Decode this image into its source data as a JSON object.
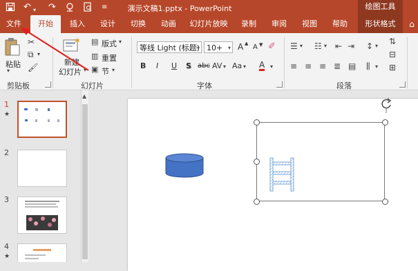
{
  "titlebar": {
    "title": "演示文稿1.pptx - PowerPoint",
    "context_header": "绘图工具",
    "qa_icons": [
      "save-icon",
      "undo-icon",
      "redo-icon",
      "touch-mode-icon",
      "preview-icon",
      "customize-icon"
    ]
  },
  "tabs": [
    {
      "label": "文件"
    },
    {
      "label": "开始"
    },
    {
      "label": "插入"
    },
    {
      "label": "设计"
    },
    {
      "label": "切换"
    },
    {
      "label": "动画"
    },
    {
      "label": "幻灯片放映"
    },
    {
      "label": "录制"
    },
    {
      "label": "审阅"
    },
    {
      "label": "视图"
    },
    {
      "label": "帮助"
    },
    {
      "label": "形状格式"
    }
  ],
  "ribbon": {
    "clipboard": {
      "label": "剪贴板",
      "paste": "粘贴"
    },
    "slides": {
      "label": "幻灯片",
      "new_slide_l1": "新建",
      "new_slide_l2": "幻灯片",
      "layout": "版式",
      "reset": "重置",
      "section": "节"
    },
    "font": {
      "label": "字体",
      "font_name": "等线 Light (标题)",
      "font_size": "10+",
      "bold": "B",
      "italic": "I",
      "underline": "U",
      "shadow": "S",
      "strike": "abc",
      "spacing": "AV",
      "case": "Aa",
      "font_color": "A",
      "grow": "A",
      "shrink": "A"
    },
    "paragraph": {
      "label": "段落"
    }
  },
  "thumbnails": [
    {
      "number": "1",
      "star": "★"
    },
    {
      "number": "2",
      "star": ""
    },
    {
      "number": "3",
      "star": ""
    },
    {
      "number": "4",
      "star": "★"
    }
  ],
  "colors": {
    "accent": "#b7472a",
    "accent_dark": "#8f3820",
    "selection": "#c0502a",
    "shape_fill": "#4472c4",
    "arrow": "#e02020"
  }
}
